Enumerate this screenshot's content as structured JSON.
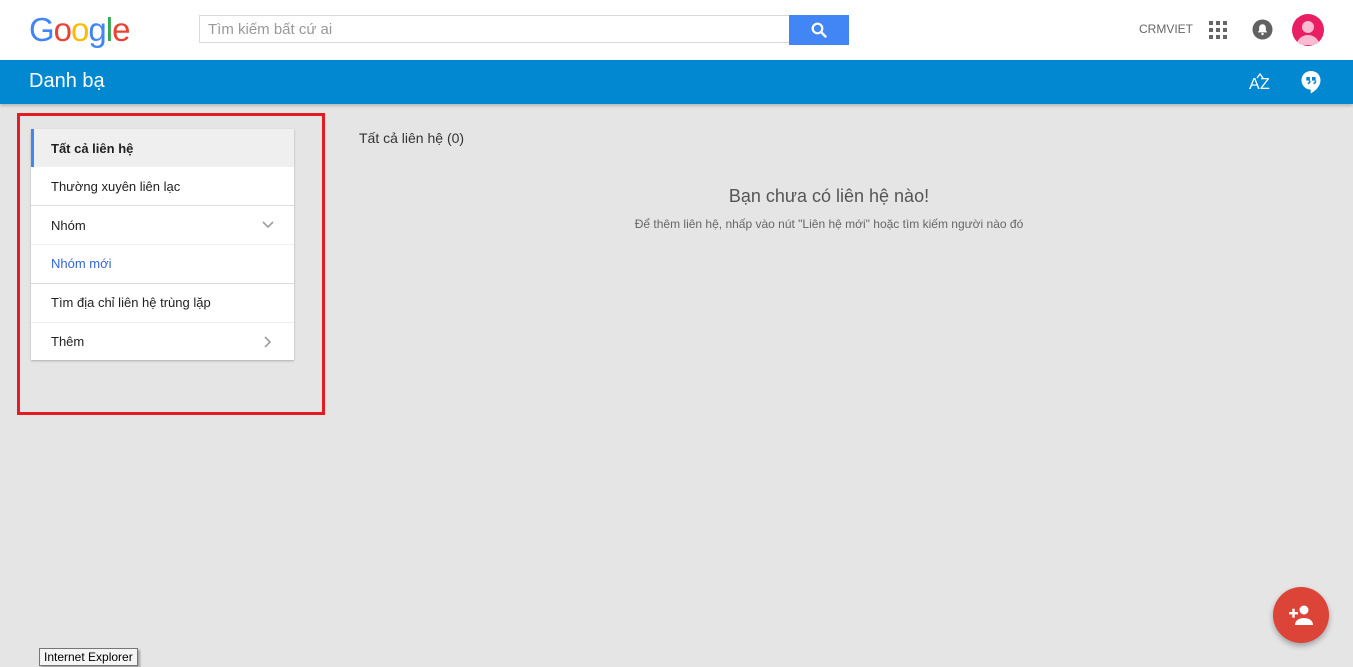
{
  "header": {
    "logo_letters": [
      {
        "char": "G",
        "color": "#4285f4"
      },
      {
        "char": "o",
        "color": "#ea4335"
      },
      {
        "char": "o",
        "color": "#fbbc05"
      },
      {
        "char": "g",
        "color": "#4285f4"
      },
      {
        "char": "l",
        "color": "#34a853"
      },
      {
        "char": "e",
        "color": "#ea4335"
      }
    ],
    "search_placeholder": "Tìm kiếm bất cứ ai",
    "search_value": "",
    "account_name": "CRMVIET"
  },
  "appbar": {
    "title": "Danh bạ",
    "color": "#0288d1",
    "sort_icon": "sort-az-icon",
    "hangouts_icon": "hangouts-icon"
  },
  "sidebar": {
    "items": [
      {
        "label": "Tất cả liên hệ",
        "active": true
      },
      {
        "label": "Thường xuyên liên lạc"
      },
      {
        "label": "Nhóm",
        "icon": "chevron-down-icon"
      },
      {
        "label": "Nhóm mới",
        "link": true
      },
      {
        "label": "Tìm địa chỉ liên hệ trùng lặp"
      },
      {
        "label": "Thêm",
        "icon": "chevron-right-icon"
      }
    ]
  },
  "main": {
    "heading": "Tất cả liên hệ (0)",
    "empty_title": "Bạn chưa có liên hệ nào!",
    "empty_hint": "Để thêm liên hệ, nhấp vào nút \"Liên hệ mới\" hoặc tìm kiếm người nào đó"
  },
  "fab": {
    "icon": "add-person-icon",
    "color": "#db4437"
  },
  "tooltip": {
    "text": "Internet Explorer"
  },
  "colors": {
    "accent": "#4285f4",
    "highlight_frame": "#e31b23",
    "link": "#3367d6"
  }
}
